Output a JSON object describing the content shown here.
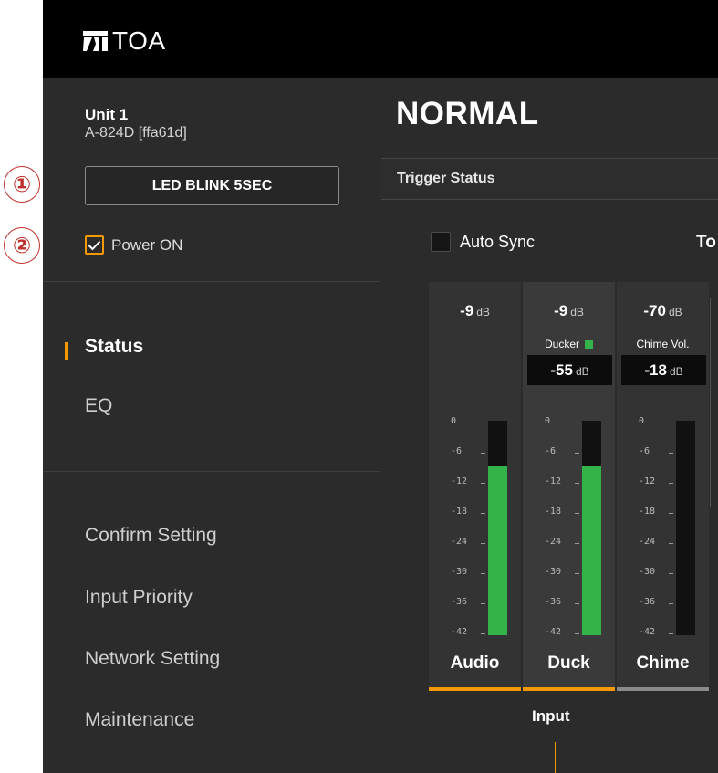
{
  "annotations": [
    "①",
    "②"
  ],
  "header": {
    "brand": "TOA"
  },
  "sidebar": {
    "unit_title": "Unit 1",
    "unit_model": "A-824D [ffa61d]",
    "led_button": "LED BLINK 5SEC",
    "power_label": "Power ON",
    "power_checked": true,
    "nav": [
      {
        "label": "Status",
        "active": true
      },
      {
        "label": "EQ",
        "active": false
      }
    ],
    "settings": [
      "Confirm Setting",
      "Input Priority",
      "Network Setting",
      "Maintenance"
    ]
  },
  "main": {
    "mode": "NORMAL",
    "trigger_status": "Trigger Status",
    "auto_sync": {
      "label": "Auto Sync",
      "checked": false
    },
    "cut_heading": "To",
    "meter_scale": [
      "0",
      "-6",
      "-12",
      "-18",
      "-24",
      "-30",
      "-36",
      "-42"
    ],
    "channels": [
      {
        "name": "Audio",
        "level": "-9",
        "unit": "dB",
        "sub_label": "",
        "sub_value": "",
        "sub_unit": "",
        "meter_db": -9,
        "underline": "#f39800"
      },
      {
        "name": "Duck",
        "level": "-9",
        "unit": "dB",
        "sub_label": "Ducker",
        "sub_value": "-55",
        "sub_unit": "dB",
        "meter_db": -9,
        "underline": "#f39800"
      },
      {
        "name": "Chime",
        "level": "-70",
        "unit": "dB",
        "sub_label": "Chime Vol.",
        "sub_value": "-18",
        "sub_unit": "dB",
        "meter_db": -70,
        "underline": "#8a8a8a"
      }
    ],
    "group_label": "Input"
  },
  "colors": {
    "accent": "#f39800",
    "meter_green": "#33b34a",
    "callout": "#c0302a"
  }
}
